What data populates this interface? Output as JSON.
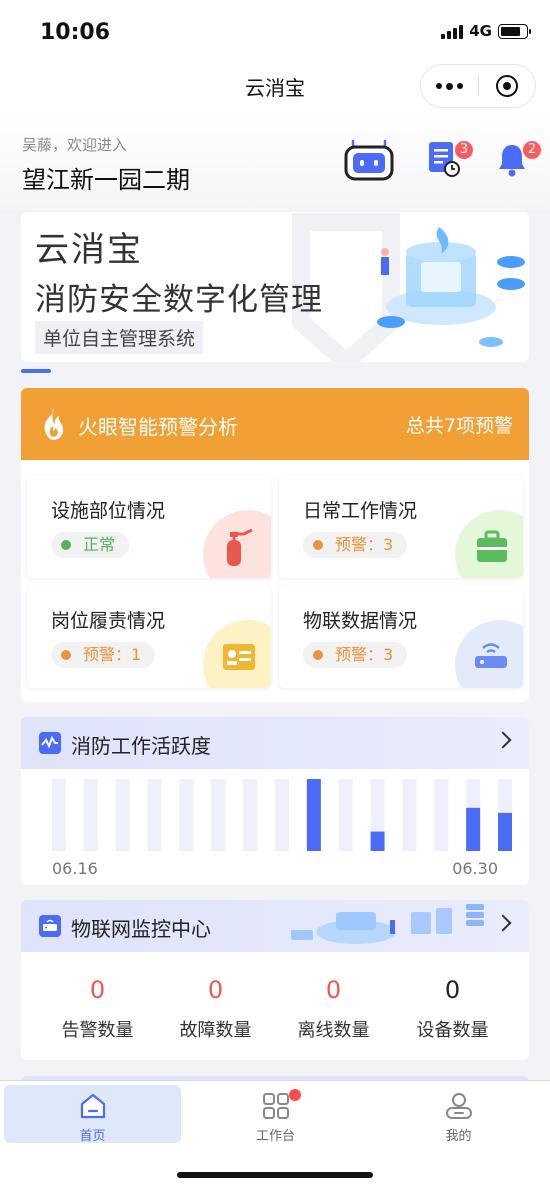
{
  "status_bar": {
    "time": "10:06",
    "network": "4G"
  },
  "navbar": {
    "title": "云消宝"
  },
  "header": {
    "greeting": "吴藤，欢迎进入",
    "site_name": "望江新一园二期",
    "task_badge": "3",
    "bell_badge": "2"
  },
  "banner": {
    "title": "云消宝",
    "subtitle": "消防安全数字化管理",
    "tag": "单位自主管理系统"
  },
  "warning": {
    "title": "火眼智能预警分析",
    "total": "总共7项预警",
    "cells": [
      {
        "title": "设施部位情况",
        "status": "正常"
      },
      {
        "title": "日常工作情况",
        "status": "预警：3"
      },
      {
        "title": "岗位履责情况",
        "status": "预警：1"
      },
      {
        "title": "物联数据情况",
        "status": "预警：3"
      }
    ]
  },
  "activity": {
    "title": "消防工作活跃度",
    "start_label": "06.16",
    "end_label": "06.30"
  },
  "chart_data": {
    "type": "bar",
    "title": "消防工作活跃度",
    "categories": [
      "06.16",
      "",
      "",
      "",
      "",
      "",
      "",
      "",
      "",
      "",
      "",
      "",
      "",
      "",
      "06.30"
    ],
    "values": [
      0,
      0,
      0,
      0,
      0,
      0,
      0,
      0,
      1,
      0,
      0.27,
      0,
      0,
      0.6,
      0.53
    ],
    "ylim": [
      0,
      1
    ],
    "bar_color": "#4a6cf7",
    "track_color": "#eef0fb"
  },
  "iot": {
    "title": "物联网监控中心",
    "stats": [
      {
        "value": "0",
        "label": "告警数量"
      },
      {
        "value": "0",
        "label": "故障数量"
      },
      {
        "value": "0",
        "label": "离线数量"
      },
      {
        "value": "0",
        "label": "设备数量"
      }
    ]
  },
  "tabbar": {
    "items": [
      {
        "label": "首页"
      },
      {
        "label": "工作台"
      },
      {
        "label": "我的"
      }
    ]
  },
  "colors": {
    "accent": "#4a6cf7",
    "warning": "#f0a034",
    "alert": "#e65c4f",
    "ok": "#57b15c"
  }
}
